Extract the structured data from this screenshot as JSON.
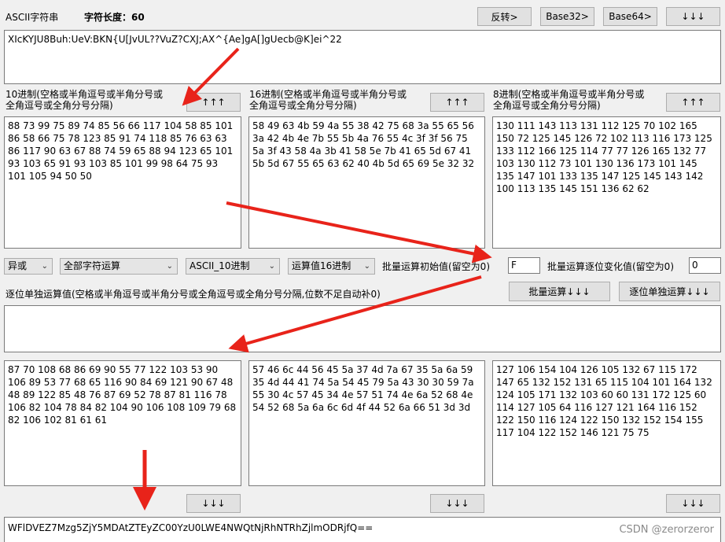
{
  "header": {
    "title": "ASCII字符串",
    "length_label": "字符长度：60",
    "buttons": [
      "反转>",
      "Base32>",
      "Base64>",
      "↓↓↓"
    ]
  },
  "ascii_input": "XIcKYJU8Buh:UeV:BKN{U[JvUL??VuZ?CXJ;AX^{Ae]gA[]gUecb@K]ei^22",
  "decimal": {
    "label": "10进制(空格或半角逗号或半角分号或全角逗号或全角分号分隔)",
    "button": "↑↑↑",
    "value": "88 73 99 75 89 74 85 56 66 117 104 58 85 101 86 58 66 75 78 123 85 91 74 118 85 76 63 63 86 117 90 63 67 88 74 59 65 88 94 123 65 101 93 103 65 91 93 103 85 101 99 98 64 75 93 101 105 94 50 50"
  },
  "hex": {
    "label": "16进制(空格或半角逗号或半角分号或全角逗号或全角分号分隔)",
    "button": "↑↑↑",
    "value": "58 49 63 4b 59 4a 55 38 42 75 68 3a 55 65 56 3a 42 4b 4e 7b 55 5b 4a 76 55 4c 3f 3f 56 75 5a 3f 43 58 4a 3b 41 58 5e 7b 41 65 5d 67 41 5b 5d 67 55 65 63 62 40 4b 5d 65 69 5e 32 32"
  },
  "octal": {
    "label": "8进制(空格或半角逗号或半角分号或全角逗号或全角分号分隔)",
    "button": "↑↑↑",
    "value": "130 111 143 113 131 112 125 70 102 165 150 72 125 145 126 72 102 113 116 173 125 133 112 166 125 114 77 77 126 165 132 77 103 130 112 73 101 130 136 173 101 145 135 147 101 133 135 147 125 145 143 142 100 113 135 145 151 136 62 62"
  },
  "options": {
    "op_select": "异或",
    "scope_select": "全部字符运算",
    "mode_select": "ASCII_10进制",
    "value_select": "运算值16进制",
    "batch_init_label": "批量运算初始值(留空为0)",
    "batch_init_value": "F",
    "batch_step_label": "批量运算逐位变化值(留空为0)",
    "batch_step_value": "0"
  },
  "bitwise": {
    "label": "逐位单独运算值(空格或半角逗号或半角分号或全角逗号或全角分号分隔,位数不足自动补0)",
    "batch_button": "批量运算↓↓↓",
    "single_button": "逐位单独运算↓↓↓",
    "value": ""
  },
  "results": {
    "decimal": "87 70 108 68 86 69 90 55 77 122 103 53 90 106 89 53 77 68 65 116 90 84 69 121 90 67 48 48 89 122 85 48 76 87 69 52 78 87 81 116 78 106 82 104 78 84 82 104 90 106 108 109 79 68 82 106 102 81 61 61",
    "hex": "57 46 6c 44 56 45 5a 37 4d 7a 67 35 5a 6a 59 35 4d 44 41 74 5a 54 45 79 5a 43 30 30 59 7a 55 30 4c 57 45 34 4e 57 51 74 4e 6a 52 68 4e 54 52 68 5a 6a 6c 6d 4f 44 52 6a 66 51 3d 3d",
    "octal": "127 106 154 104 126 105 132 67 115 172 147 65 132 152 131 65 115 104 101 164 132 124 105 171 132 103 60 60 131 172 125 60 114 127 105 64 116 127 121 164 116 152 122 150 116 124 122 150 132 152 154 155 117 104 122 152 146 121 75 75",
    "down_button": "↓↓↓"
  },
  "output": "WFlDVEZ7Mzg5ZjY5MDAtZTEyZC00YzU0LWE4NWQtNjRhNTRhZjlmODRjfQ==",
  "watermark": "CSDN @zerorzeror",
  "colors": {
    "arrow": "#e8231a",
    "background": "#f0f0f0"
  }
}
